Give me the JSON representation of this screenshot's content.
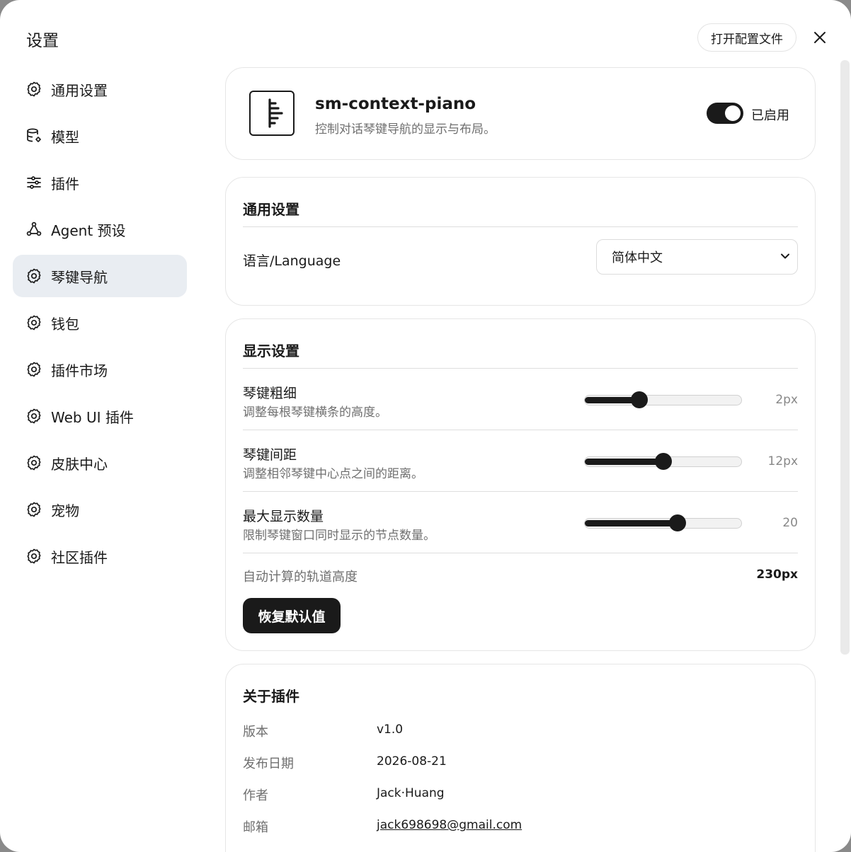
{
  "dialog": {
    "title": "设置",
    "open_config_label": "打开配置文件",
    "close_icon": "close-icon"
  },
  "sidebar": {
    "items": [
      {
        "label": "通用设置",
        "icon": "gear-icon",
        "active": false
      },
      {
        "label": "模型",
        "icon": "database-gear-icon",
        "active": false
      },
      {
        "label": "插件",
        "icon": "sliders-icon",
        "active": false
      },
      {
        "label": "Agent 预设",
        "icon": "agent-nodes-icon",
        "active": false
      },
      {
        "label": "琴键导航",
        "icon": "gear-icon",
        "active": true
      },
      {
        "label": "钱包",
        "icon": "gear-icon",
        "active": false
      },
      {
        "label": "插件市场",
        "icon": "gear-icon",
        "active": false
      },
      {
        "label": "Web UI 插件",
        "icon": "gear-icon",
        "active": false
      },
      {
        "label": "皮肤中心",
        "icon": "gear-icon",
        "active": false
      },
      {
        "label": "宠物",
        "icon": "gear-icon",
        "active": false
      },
      {
        "label": "社区插件",
        "icon": "gear-icon",
        "active": false
      }
    ]
  },
  "plugin": {
    "name": "sm-context-piano",
    "description": "控制对话琴键导航的显示与布局。",
    "enabled": true,
    "enabled_label": "已启用"
  },
  "general": {
    "title": "通用设置",
    "language_label": "语言/Language",
    "language_value": "简体中文"
  },
  "display": {
    "title": "显示设置",
    "settings": [
      {
        "name": "琴键粗细",
        "hint": "调整每根琴键横条的高度。",
        "value": "2px",
        "level": 0.35
      },
      {
        "name": "琴键间距",
        "hint": "调整相邻琴键中心点之间的距离。",
        "value": "12px",
        "level": 0.5
      },
      {
        "name": "最大显示数量",
        "hint": "限制琴键窗口同时显示的节点数量。",
        "value": "20",
        "level": 0.595
      }
    ],
    "auto_label": "自动计算的轨道高度",
    "auto_value": "230px",
    "reset_label": "恢复默认值"
  },
  "about": {
    "title": "关于插件",
    "rows": [
      {
        "key": "版本",
        "value": "v1.0"
      },
      {
        "key": "发布日期",
        "value": "2026-08-21"
      },
      {
        "key": "作者",
        "value": "Jack·Huang"
      },
      {
        "key": "邮箱",
        "value": "jack698698@gmail.com"
      }
    ]
  }
}
